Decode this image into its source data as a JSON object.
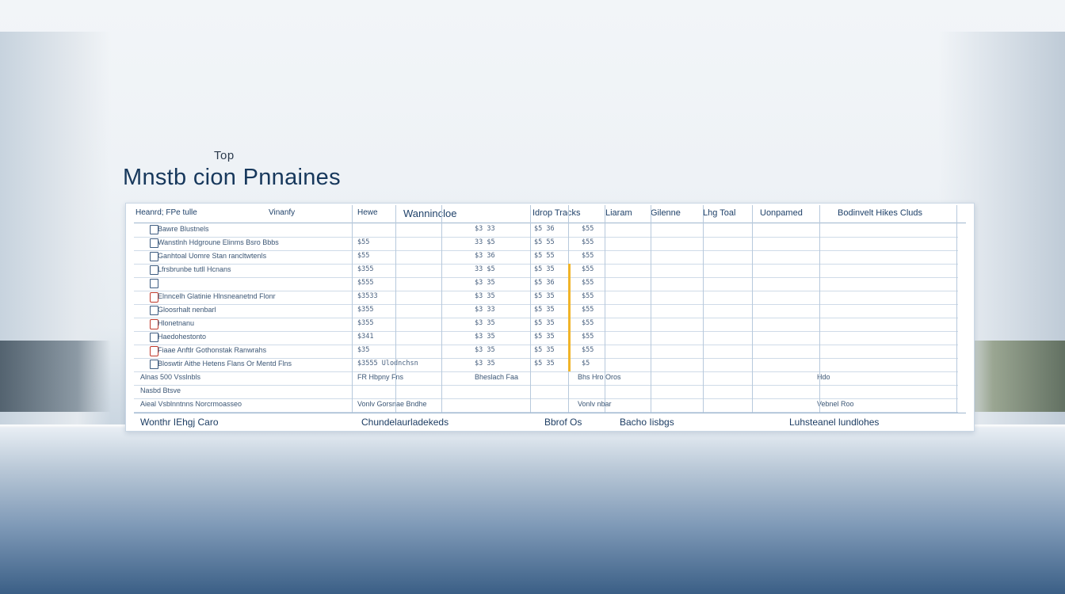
{
  "heading": {
    "kicker": "Top",
    "title": "Mnstb cion Pnnaines"
  },
  "table": {
    "headers": [
      "Heanrd; FPe tulle",
      "Vinanfy",
      "Hewe",
      "Wannincloe",
      "Idrop Tracks",
      "Liaram",
      "Gilenne",
      "Lhg Toal",
      "Uonpamed",
      "Bodinvelt Hikes Cluds"
    ],
    "rows": [
      {
        "label": "Bawre   Blustnels",
        "c1": "",
        "c2": "$3 33",
        "c3": "$5 36",
        "c4": "$55"
      },
      {
        "label": "Wanstlnh Hdgroune Elinms Bsro Bbbs",
        "c1": "$55",
        "c2": "33 $5",
        "c3": "$5 55",
        "c4": "$55"
      },
      {
        "label": "Ganhtoal Uomre Stan rancltwtenls",
        "c1": "$55",
        "c2": "$3 36",
        "c3": "$5 55",
        "c4": "$55"
      },
      {
        "label": "Lfrsbrunbe tutll Hcnans",
        "c1": "$355",
        "c2": "33 $5",
        "c3": "$5 35",
        "c4": "$55"
      },
      {
        "label": "",
        "c1": "$555",
        "c2": "$3 35",
        "c3": "$5 36",
        "c4": "$55"
      },
      {
        "label": "Elnncelh Glatinie Hlnsneanetnd Flonr",
        "c1": "$3533",
        "c2": "$3 35",
        "c3": "$5 35",
        "c4": "$55"
      },
      {
        "label": "Gloosrhalt nenbarl",
        "c1": "$355",
        "c2": "$3 33",
        "c3": "$5 35",
        "c4": "$55"
      },
      {
        "label": "Hlonetnanu",
        "c1": "$355",
        "c2": "$3 35",
        "c3": "$5 35",
        "c4": "$55"
      },
      {
        "label": "Haedohestonto",
        "c1": "$341",
        "c2": "$3 35",
        "c3": "$5 35",
        "c4": "$55"
      },
      {
        "label": "Fiaae Anftlr Gothonstak Ranwrahs",
        "c1": "$35",
        "c2": "$3 35",
        "c3": "$5 35",
        "c4": "$55"
      },
      {
        "label": "Bloswtir Aithe Hetens Flans Or Mentd Flns",
        "c1": "$3555 Ulodnchsn",
        "c2": "$3 35",
        "c3": "$5 35",
        "c4": "$5"
      }
    ],
    "summary_rows": [
      {
        "label": "Alnas 500 Vsslnbls",
        "c1": "FR Hbpny Fns",
        "c2": "Bheslach Faa",
        "c3": "Bhs Hro Oros",
        "c5": "Hdo"
      },
      {
        "label": "Nasbd Btsve",
        "c1": "",
        "c2": "",
        "c3": "",
        "c5": ""
      },
      {
        "label": "Aieal Vsblnntnns Norcrmoasseo",
        "c1": "Vonlv Gorsnae Bndhe",
        "c2": "",
        "c3": "Vonlv nbar",
        "c5": "Vebnel Roo"
      }
    ],
    "footer": [
      "Wonthr IEhgj Caro",
      "Chundelaurladekeds",
      "Bbrof Os",
      "Bacho Iisbgs",
      "Luhsteanel lundlohes"
    ]
  },
  "colors": {
    "accent": "#17385c",
    "grid": "#b7c9dc",
    "highlight": "#f0b429",
    "icon_red": "#c0392b"
  }
}
